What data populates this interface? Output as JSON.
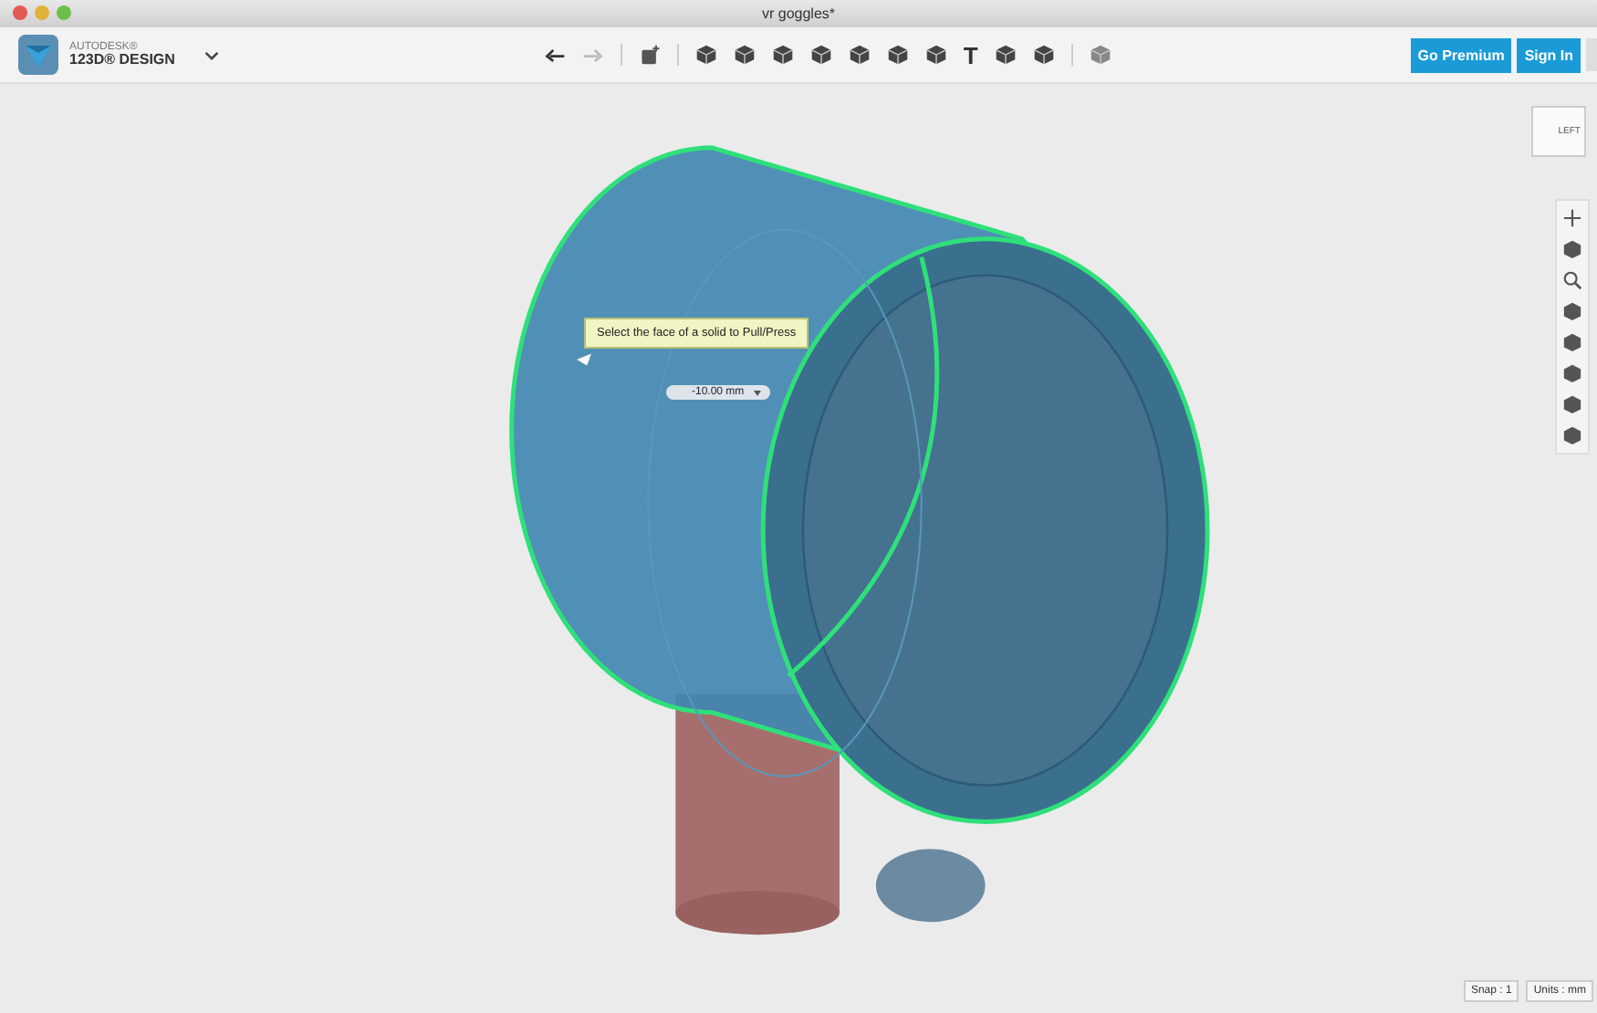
{
  "window": {
    "title": "vr goggles*"
  },
  "app": {
    "brand_top": "AUTODESK®",
    "brand_name": "123D® DESIGN"
  },
  "toolbar": {
    "undo_disabled": false,
    "redo_disabled": true,
    "text_tool": "T"
  },
  "account": {
    "premium": "Go Premium",
    "sign_in": "Sign In"
  },
  "view_cube": {
    "face": "LEFT"
  },
  "tooltip": "Select the face of a solid to Pull/Press",
  "dimension": {
    "value": "-10.00 mm"
  },
  "status_bar": {
    "snap": "Snap : 1",
    "units": "Units : mm"
  }
}
